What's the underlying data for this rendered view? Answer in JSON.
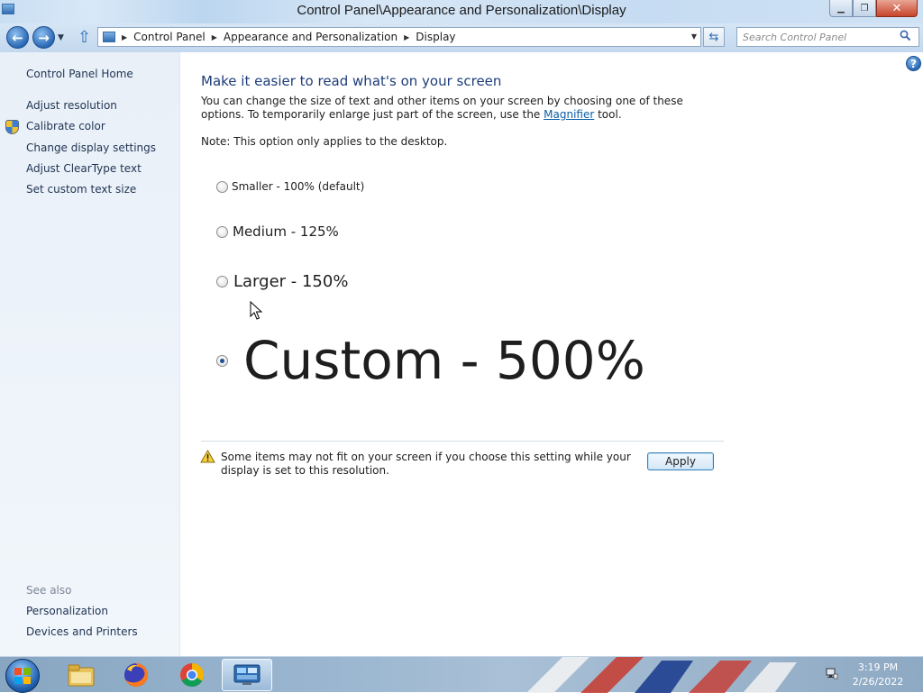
{
  "window": {
    "title": "Control Panel\\Appearance and Personalization\\Display",
    "minimize_icon": "minimize-icon",
    "maximize_icon": "restore-icon",
    "close_icon": "close-icon"
  },
  "address_bar": {
    "breadcrumbs": [
      "Control Panel",
      "Appearance and Personalization",
      "Display"
    ],
    "search_placeholder": "Search Control Panel"
  },
  "sidebar": {
    "home_link": "Control Panel Home",
    "tasks": [
      {
        "label": "Adjust resolution",
        "icon": ""
      },
      {
        "label": "Calibrate color",
        "icon": "shield-icon"
      },
      {
        "label": "Change display settings",
        "icon": ""
      },
      {
        "label": "Adjust ClearType text",
        "icon": ""
      },
      {
        "label": "Set custom text size",
        "icon": ""
      }
    ],
    "see_also_heading": "See also",
    "see_also": [
      "Personalization",
      "Devices and Printers"
    ]
  },
  "main": {
    "heading": "Make it easier to read what's on your screen",
    "intro_before_link": "You can change the size of text and other items on your screen by choosing one of these options. To temporarily enlarge just part of the screen, use the ",
    "intro_link": "Magnifier",
    "intro_after_link": " tool.",
    "note": "Note: This option only applies to the desktop.",
    "options": [
      {
        "label": "Smaller - 100% (default)",
        "checked": false
      },
      {
        "label": "Medium - 125%",
        "checked": false
      },
      {
        "label": "Larger - 150%",
        "checked": false
      },
      {
        "label": "Custom - 500%",
        "checked": true
      }
    ],
    "warning": "Some items may not fit on your screen if you choose this setting while your display is set to this resolution.",
    "apply_label": "Apply"
  },
  "taskbar": {
    "apps": [
      "file-explorer-icon",
      "firefox-icon",
      "chrome-icon",
      "control-panel-icon"
    ],
    "active_app": "control-panel-icon",
    "time": "3:19 PM",
    "date": "2/26/2022"
  },
  "colors": {
    "heading": "#1e3d7a",
    "link": "#0b5ea8",
    "sidebar_bg": "#e9f0f8",
    "taskbar": "#9db8d1"
  }
}
